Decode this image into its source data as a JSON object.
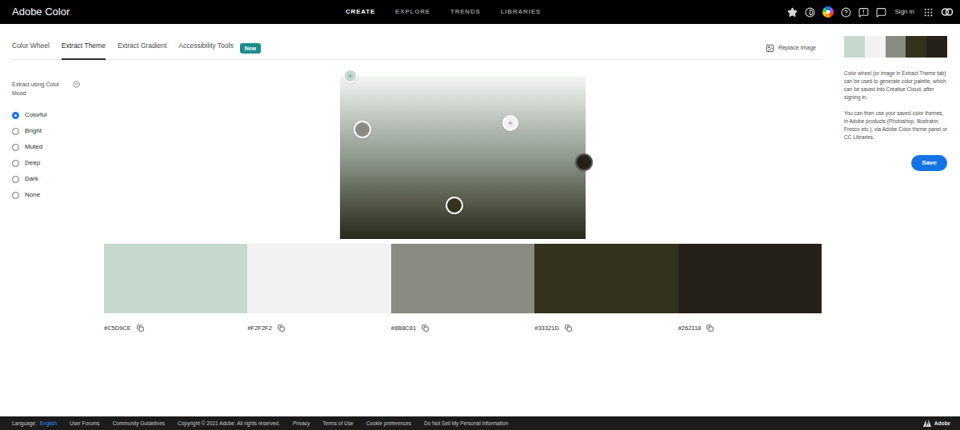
{
  "app": {
    "title": "Adobe Color"
  },
  "nav": [
    {
      "label": "CREATE",
      "selected": true
    },
    {
      "label": "EXPLORE",
      "selected": false
    },
    {
      "label": "TRENDS",
      "selected": false
    },
    {
      "label": "LIBRARIES",
      "selected": false
    }
  ],
  "header_actions": {
    "sign_in": "Sign in"
  },
  "tabs": [
    {
      "label": "Color Wheel",
      "selected": false
    },
    {
      "label": "Extract Theme",
      "selected": true
    },
    {
      "label": "Extract Gradient",
      "selected": false
    },
    {
      "label": "Accessibility Tools",
      "selected": false,
      "badge": "New"
    }
  ],
  "replace_image": "Replace Image",
  "mood": {
    "label": "Extract using Color Mood",
    "options": [
      {
        "label": "Colorful",
        "selected": true
      },
      {
        "label": "Bright",
        "selected": false
      },
      {
        "label": "Muted",
        "selected": false
      },
      {
        "label": "Deep",
        "selected": false
      },
      {
        "label": "Dark",
        "selected": false
      },
      {
        "label": "None",
        "selected": false
      }
    ]
  },
  "palette": [
    {
      "hex": "#C5D9CE",
      "color": "#c5d9ce"
    },
    {
      "hex": "#F2F2F2",
      "color": "#f2f2f2"
    },
    {
      "hex": "#8B8C81",
      "color": "#8b8c81"
    },
    {
      "hex": "#33321D",
      "color": "#33321d"
    },
    {
      "hex": "#262118",
      "color": "#262118"
    }
  ],
  "side_panel": {
    "paragraphs": [
      "Color wheel (or image in Extract Theme tab) can be used to generate color palette, which can be saved into Creative Cloud, after signing in.",
      "You can then use your saved color themes, in Adobe products (Photoshop, Illustrator, Fresco etc.), via Adobe Color theme panel or CC Libraries."
    ],
    "save": "Save"
  },
  "footer": {
    "language_label": "Language:",
    "language": "English",
    "links": [
      "User Forums",
      "Community Guidelines",
      "Copyright © 2021 Adobe. All rights reserved.",
      "Privacy",
      "Terms of Use",
      "Cookie preferences",
      "Do Not Sell My Personal Information"
    ],
    "brand": "Adobe"
  }
}
